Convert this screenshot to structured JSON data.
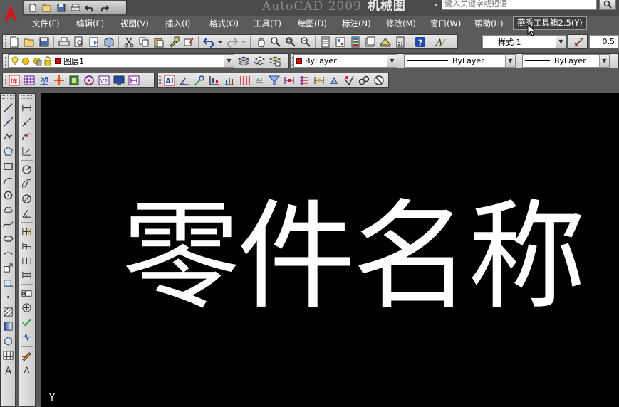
{
  "title": {
    "app": "AutoCAD 2009",
    "document": "机械图"
  },
  "search": {
    "placeholder": "键入关键字或短语"
  },
  "menu": [
    {
      "label": "文件(F)"
    },
    {
      "label": "编辑(E)"
    },
    {
      "label": "视图(V)"
    },
    {
      "label": "插入(I)"
    },
    {
      "label": "格式(O)"
    },
    {
      "label": "工具(T)"
    },
    {
      "label": "绘图(D)"
    },
    {
      "label": "标注(N)"
    },
    {
      "label": "修改(M)"
    },
    {
      "label": "窗口(W)"
    },
    {
      "label": "帮助(H)"
    },
    {
      "label": "燕秀工具箱2.5(Y)"
    }
  ],
  "styles": {
    "text_style": "样式 1",
    "scale_value": "0.5"
  },
  "layers": {
    "current": "图层1"
  },
  "properties": {
    "color": "ByLayer",
    "linetype": "ByLayer",
    "lineweight": "ByLayer"
  },
  "canvas": {
    "text": "零件名称",
    "ucs_y": "Y"
  },
  "colors": {
    "background": "#000000",
    "text": "#ffffff",
    "layer_color": "#e00000"
  }
}
